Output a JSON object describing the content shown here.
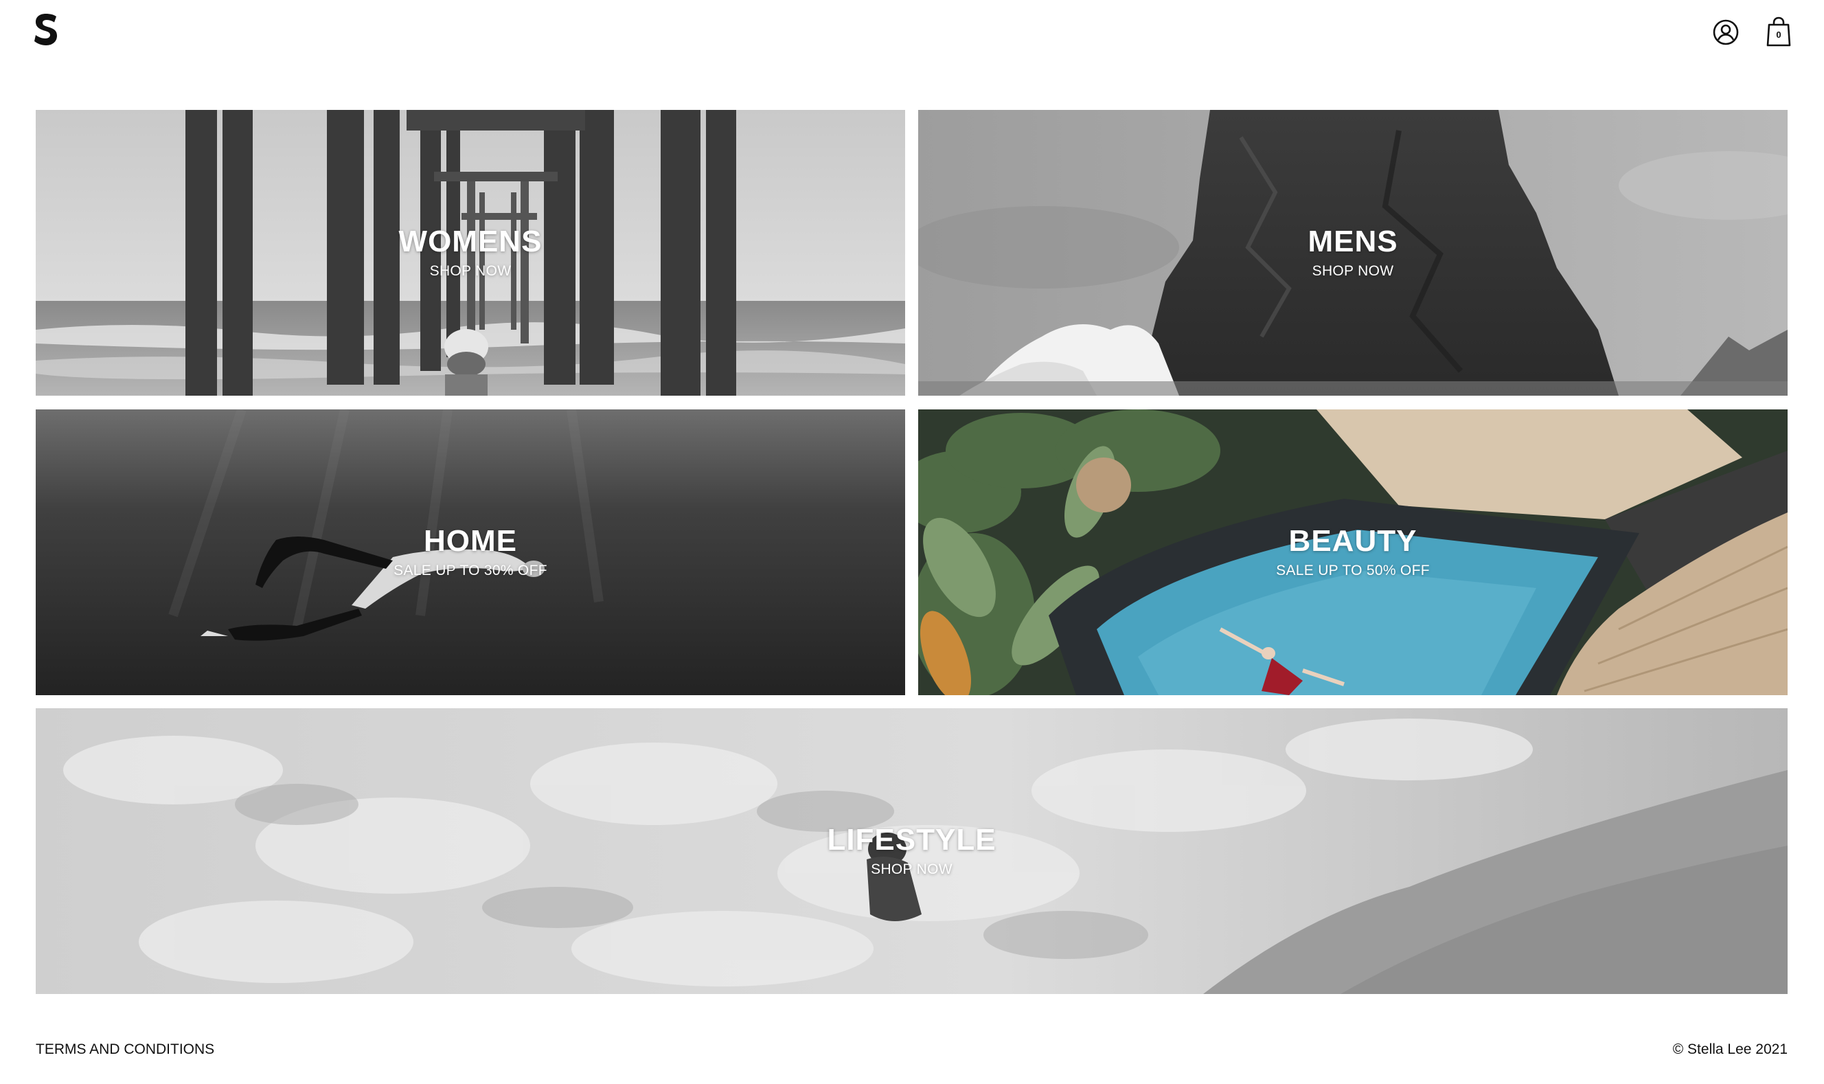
{
  "header": {
    "logo_icon": "s-logo-icon",
    "account_icon": "user-circle-icon",
    "cart_icon": "shopping-bag-icon",
    "cart_count": "0"
  },
  "tiles": [
    {
      "title": "WOMENS",
      "subtitle": "SHOP NOW"
    },
    {
      "title": "MENS",
      "subtitle": "SHOP NOW"
    },
    {
      "title": "HOME",
      "subtitle": "SALE UP TO 30% OFF"
    },
    {
      "title": "BEAUTY",
      "subtitle": "SALE UP TO 50% OFF"
    },
    {
      "title": "LIFESTYLE",
      "subtitle": "SHOP NOW"
    }
  ],
  "footer": {
    "terms_label": "TERMS AND CONDITIONS",
    "copyright": "© Stella Lee 2021"
  },
  "colors": {
    "background": "#ffffff",
    "text": "#111111",
    "overlay_text": "#ffffff",
    "pool_water": "#4aa3c0"
  }
}
